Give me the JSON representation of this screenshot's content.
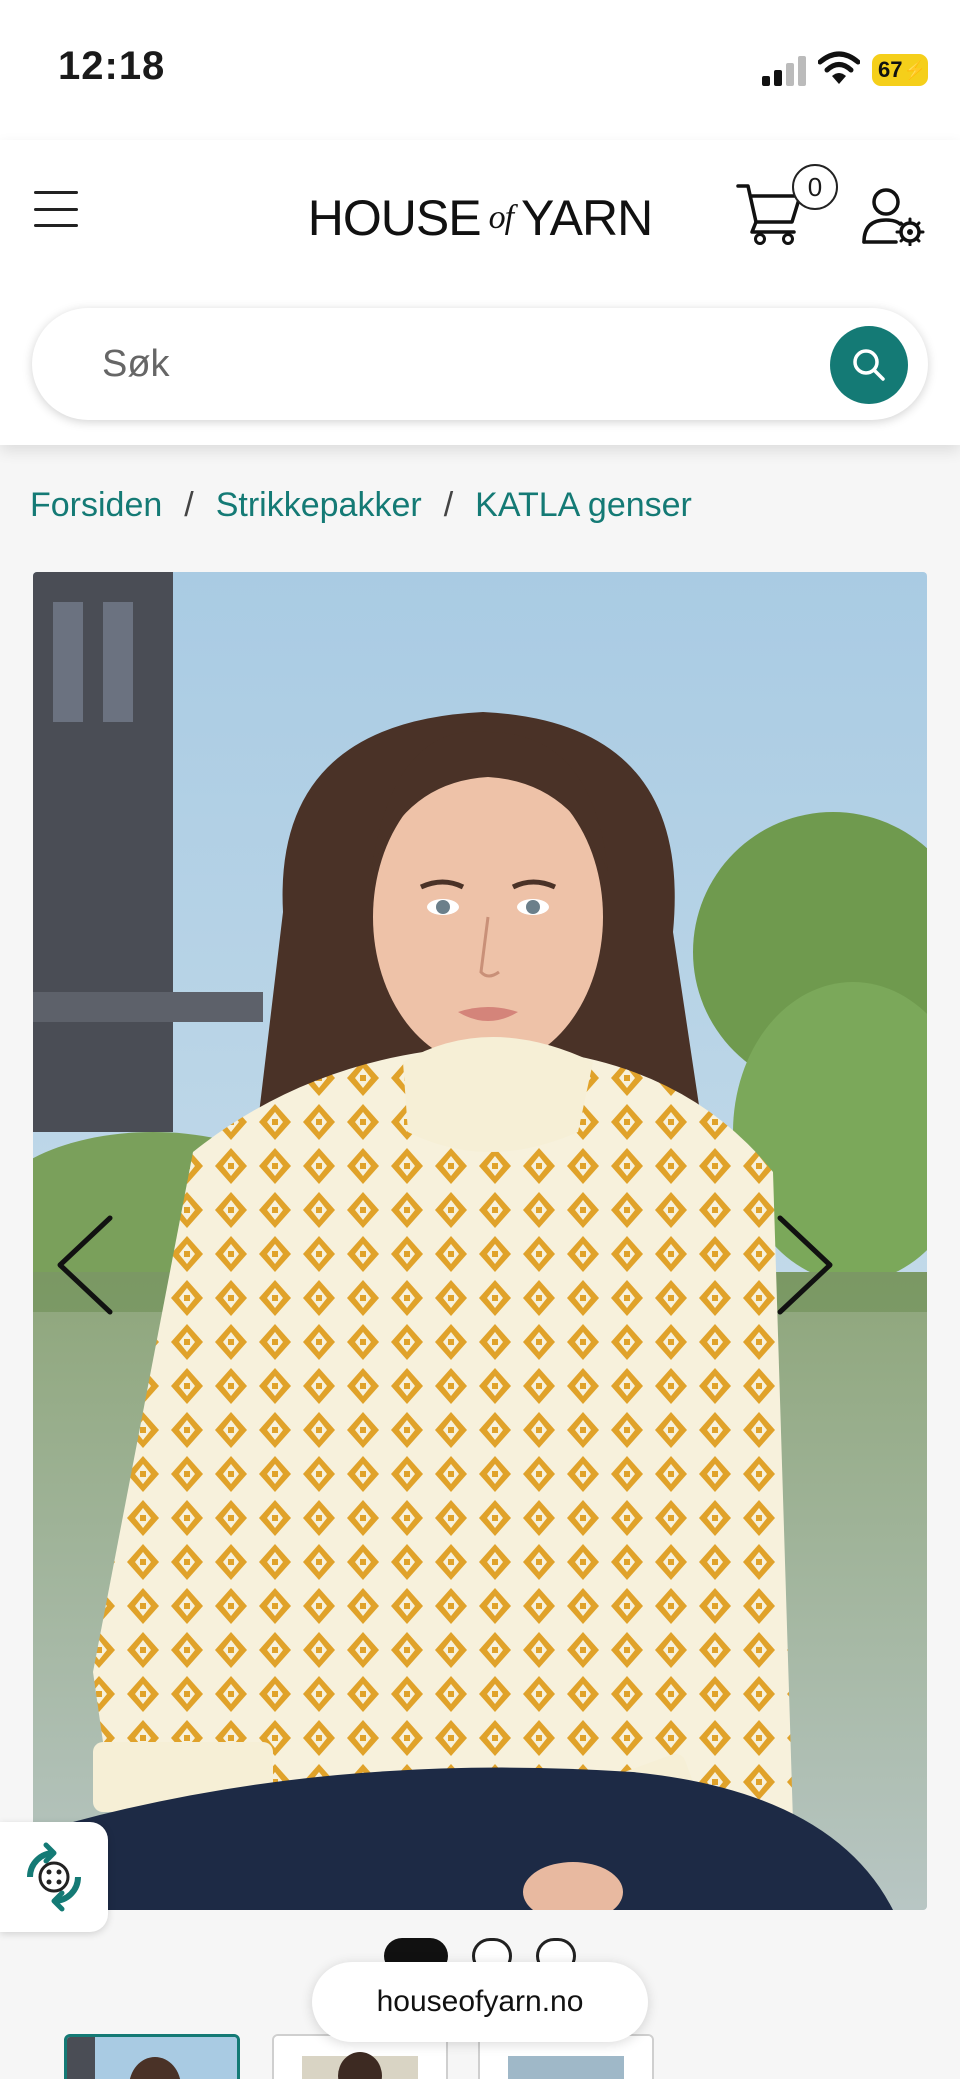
{
  "status_bar": {
    "time": "12:18",
    "battery": "67"
  },
  "header": {
    "logo_main_left": "HOUSE",
    "logo_of": "of",
    "logo_main_right": "YARN",
    "cart_count": "0",
    "icons": [
      "menu-icon",
      "cart-icon",
      "account-settings-icon"
    ]
  },
  "search": {
    "placeholder": "Søk",
    "icon": "search-icon"
  },
  "breadcrumb": {
    "items": [
      "Forsiden",
      "Strikkepakker",
      "KATLA genser"
    ],
    "separator": "/"
  },
  "product_image": {
    "alt": "KATLA genser",
    "slide_count": 3,
    "active_slide": 1
  },
  "browser": {
    "url": "houseofyarn.no"
  },
  "colors": {
    "accent": "#147a75",
    "sweater_pattern": "#e0a22a",
    "sweater_base": "#f7f1dc"
  }
}
